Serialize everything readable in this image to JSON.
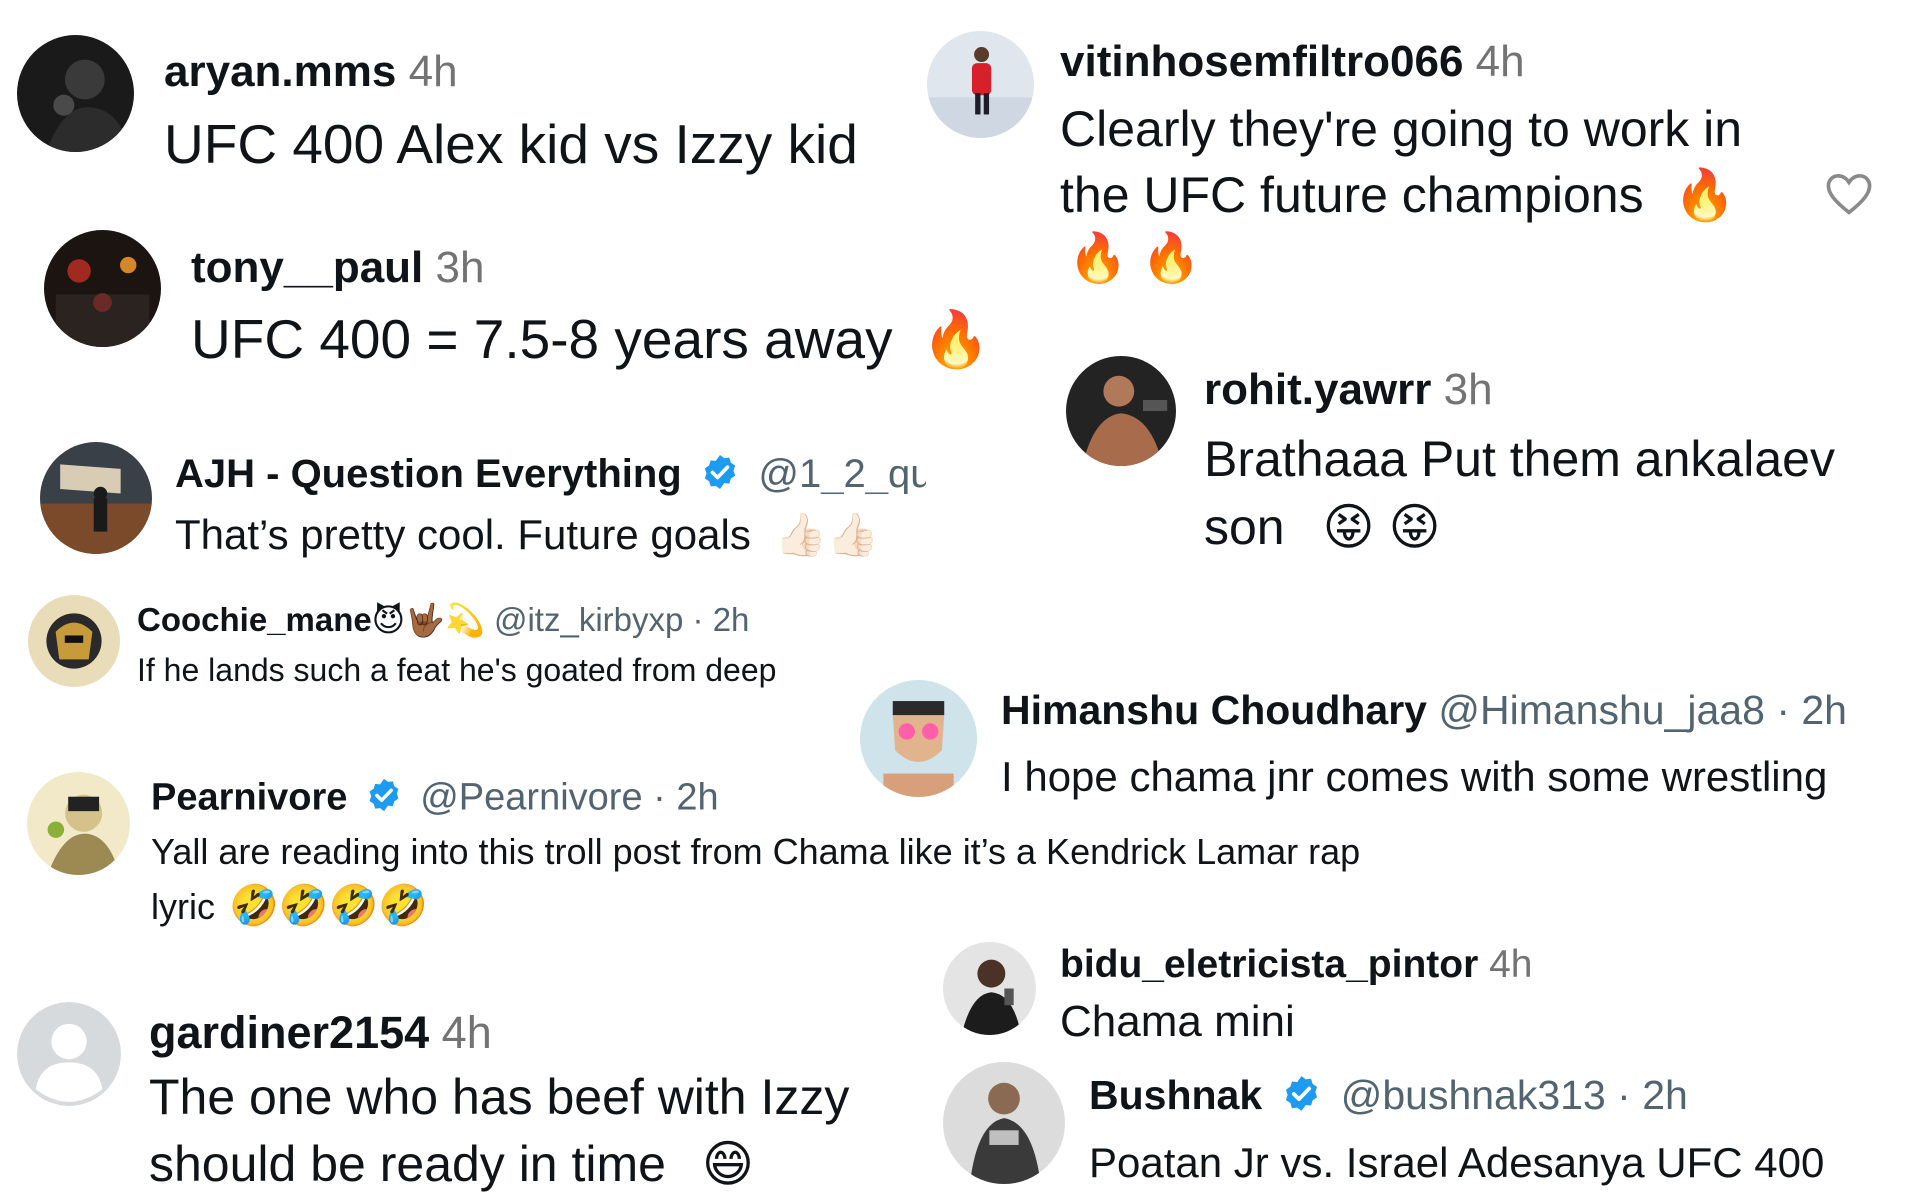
{
  "comments": [
    {
      "id": "aryan",
      "username": "aryan.mms",
      "time": "4h",
      "text": "UFC 400 Alex kid vs Izzy kid"
    },
    {
      "id": "tony",
      "username": "tony__paul",
      "time": "3h",
      "text": "UFC 400 = 7.5-8 years away",
      "emoji": "🔥"
    },
    {
      "id": "vitinho",
      "username": "vitinhosemfiltro066",
      "time": "4h",
      "text_line1": "Clearly they're going to work in",
      "text_line2": "the UFC future champions",
      "emoji_line2": "🔥",
      "emoji_line3": "🔥 🔥"
    },
    {
      "id": "rohit",
      "username": "rohit.yawrr",
      "time": "3h",
      "text_line1": "Brathaaa Put them ankalaev",
      "text_line2": "son",
      "emoji": "😝 😝"
    },
    {
      "id": "ajh",
      "username": "AJH - Question Everything",
      "handle": "@1_2_qu",
      "text": "That’s pretty cool. Future goals",
      "emoji": "👍🏻👍🏻"
    },
    {
      "id": "coochie",
      "username": "Coochie_mane",
      "username_emoji": "😈🤟🏾💫",
      "handle": "@itz_kirbyxp",
      "time": "· 2h",
      "text": "If he lands such a feat he's goated from deep"
    },
    {
      "id": "himanshu",
      "username": "Himanshu Choudhary",
      "handle": "@Himanshu_jaa8",
      "time": "· 2h",
      "text": "I hope chama jnr comes with some wrestling"
    },
    {
      "id": "pearnivore",
      "username": "Pearnivore",
      "handle": "@Pearnivore",
      "time": "· 2h",
      "text_line1": "Yall are reading into this troll post from Chama like it’s a Kendrick Lamar rap",
      "text_line2": "lyric",
      "emoji": "🤣🤣🤣🤣"
    },
    {
      "id": "bidu",
      "username": "bidu_eletricista_pintor",
      "time": "4h",
      "text": "Chama mini"
    },
    {
      "id": "gardiner",
      "username": "gardiner2154",
      "time": "4h",
      "text_line1": "The one who has beef with Izzy",
      "text_line2": "should be ready in time",
      "emoji": "😄"
    },
    {
      "id": "bushnak",
      "username": "Bushnak",
      "handle": "@bushnak313",
      "time": "· 2h",
      "text": "Poatan Jr vs. Israel Adesanya UFC 400"
    }
  ],
  "icons": {
    "verified": "verified-badge-icon",
    "like": "heart-outline-icon"
  },
  "colors": {
    "verified": "#1d9bf0",
    "meta": "#737373",
    "text": "#0f1419"
  }
}
